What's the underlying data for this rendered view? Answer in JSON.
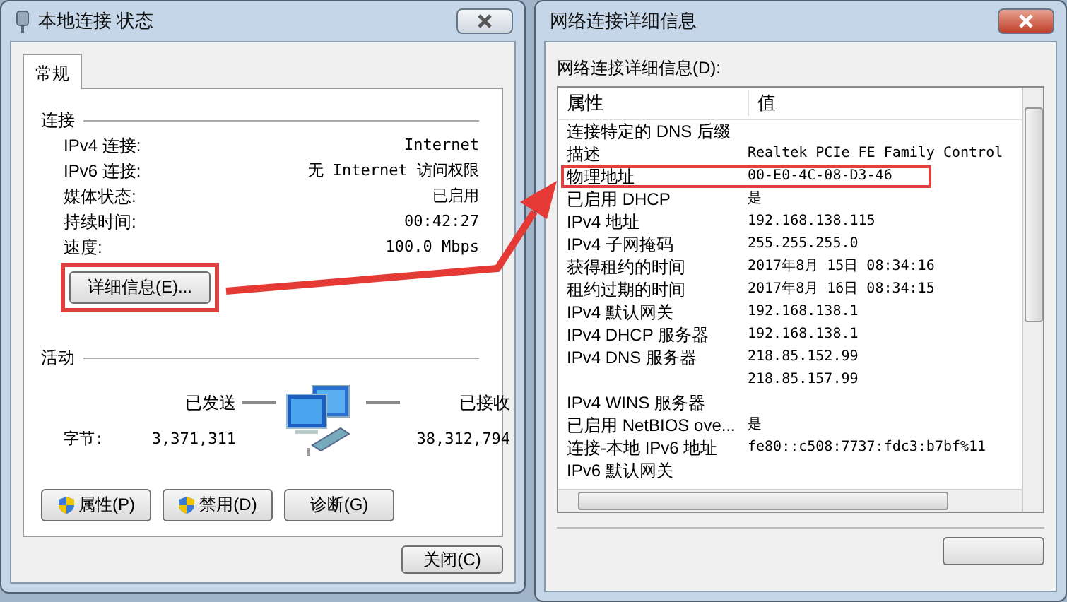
{
  "status_window": {
    "title": "本地连接 状态",
    "tabs": [
      {
        "label": "常规",
        "selected": true
      }
    ],
    "connection": {
      "heading": "连接",
      "rows": [
        {
          "label": "IPv4 连接:",
          "value": "Internet"
        },
        {
          "label": "IPv6 连接:",
          "value": "无 Internet 访问权限"
        },
        {
          "label": "媒体状态:",
          "value": "已启用"
        },
        {
          "label": "持续时间:",
          "value": "00:42:27"
        },
        {
          "label": "速度:",
          "value": "100.0 Mbps"
        }
      ]
    },
    "details_button": {
      "label": "详细信息(E)...",
      "highlighted": true
    },
    "activity": {
      "heading": "活动",
      "sent_label": "已发送",
      "received_label": "已接收",
      "bytes_label": "字节:",
      "sent": "3,371,311",
      "received": "38,312,794"
    },
    "buttons": [
      {
        "label": "属性(P)",
        "kind": "shield"
      },
      {
        "label": "禁用(D)",
        "kind": "shield"
      },
      {
        "label": "诊断(G)",
        "kind": "plain"
      }
    ],
    "close_button": "关闭(C)"
  },
  "details_window": {
    "title": "网络连接详细信息",
    "list_label": "网络连接详细信息(D):",
    "columns": [
      "属性",
      "值"
    ],
    "rows": [
      {
        "property": "连接特定的 DNS 后缀",
        "value": "",
        "highlighted": false
      },
      {
        "property": "描述",
        "value": "Realtek PCIe FE Family Control",
        "highlighted": false
      },
      {
        "property": "物理地址",
        "value": "00-E0-4C-08-D3-46",
        "highlighted": true
      },
      {
        "property": "已启用 DHCP",
        "value": "是",
        "highlighted": false
      },
      {
        "property": "IPv4 地址",
        "value": "192.168.138.115",
        "highlighted": false
      },
      {
        "property": "IPv4 子网掩码",
        "value": "255.255.255.0",
        "highlighted": false
      },
      {
        "property": "获得租约的时间",
        "value": "2017年8月 15日 08:34:16",
        "highlighted": false
      },
      {
        "property": "租约过期的时间",
        "value": "2017年8月 16日 08:34:15",
        "highlighted": false
      },
      {
        "property": "IPv4 默认网关",
        "value": "192.168.138.1",
        "highlighted": false
      },
      {
        "property": "IPv4 DHCP 服务器",
        "value": "192.168.138.1",
        "highlighted": false
      },
      {
        "property": "IPv4 DNS 服务器",
        "value": "218.85.152.99",
        "highlighted": false
      },
      {
        "property": "",
        "value": "218.85.157.99",
        "highlighted": false
      },
      {
        "property": "IPv4 WINS 服务器",
        "value": "",
        "highlighted": false
      },
      {
        "property": "已启用 NetBIOS ove...",
        "value": "是",
        "highlighted": false
      },
      {
        "property": "连接-本地 IPv6 地址",
        "value": "fe80::c508:7737:fdc3:b7bf%11",
        "highlighted": false
      },
      {
        "property": "IPv6 默认网关",
        "value": "",
        "highlighted": false
      }
    ]
  }
}
